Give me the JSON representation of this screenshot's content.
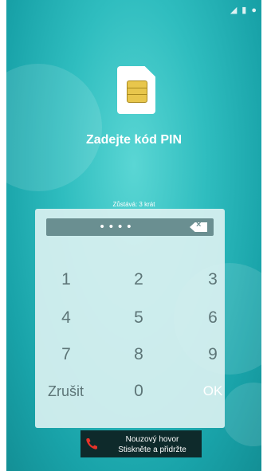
{
  "title": "Zadejte kód PIN",
  "remaining": "Zůstává: 3 krát",
  "pin_dots": "••••",
  "keys": {
    "k1": "1",
    "k2": "2",
    "k3": "3",
    "k4": "4",
    "k5": "5",
    "k6": "6",
    "k7": "7",
    "k8": "8",
    "k9": "9",
    "cancel": "Zrušit",
    "k0": "0",
    "ok": "OK"
  },
  "emergency": {
    "line1": "Nouzový hovor",
    "line2": "Stiskněte a přidržte"
  },
  "icons": [
    "signal-icon",
    "battery-icon",
    "account-icon",
    "sim-card-icon",
    "backspace-icon",
    "phone-icon"
  ]
}
